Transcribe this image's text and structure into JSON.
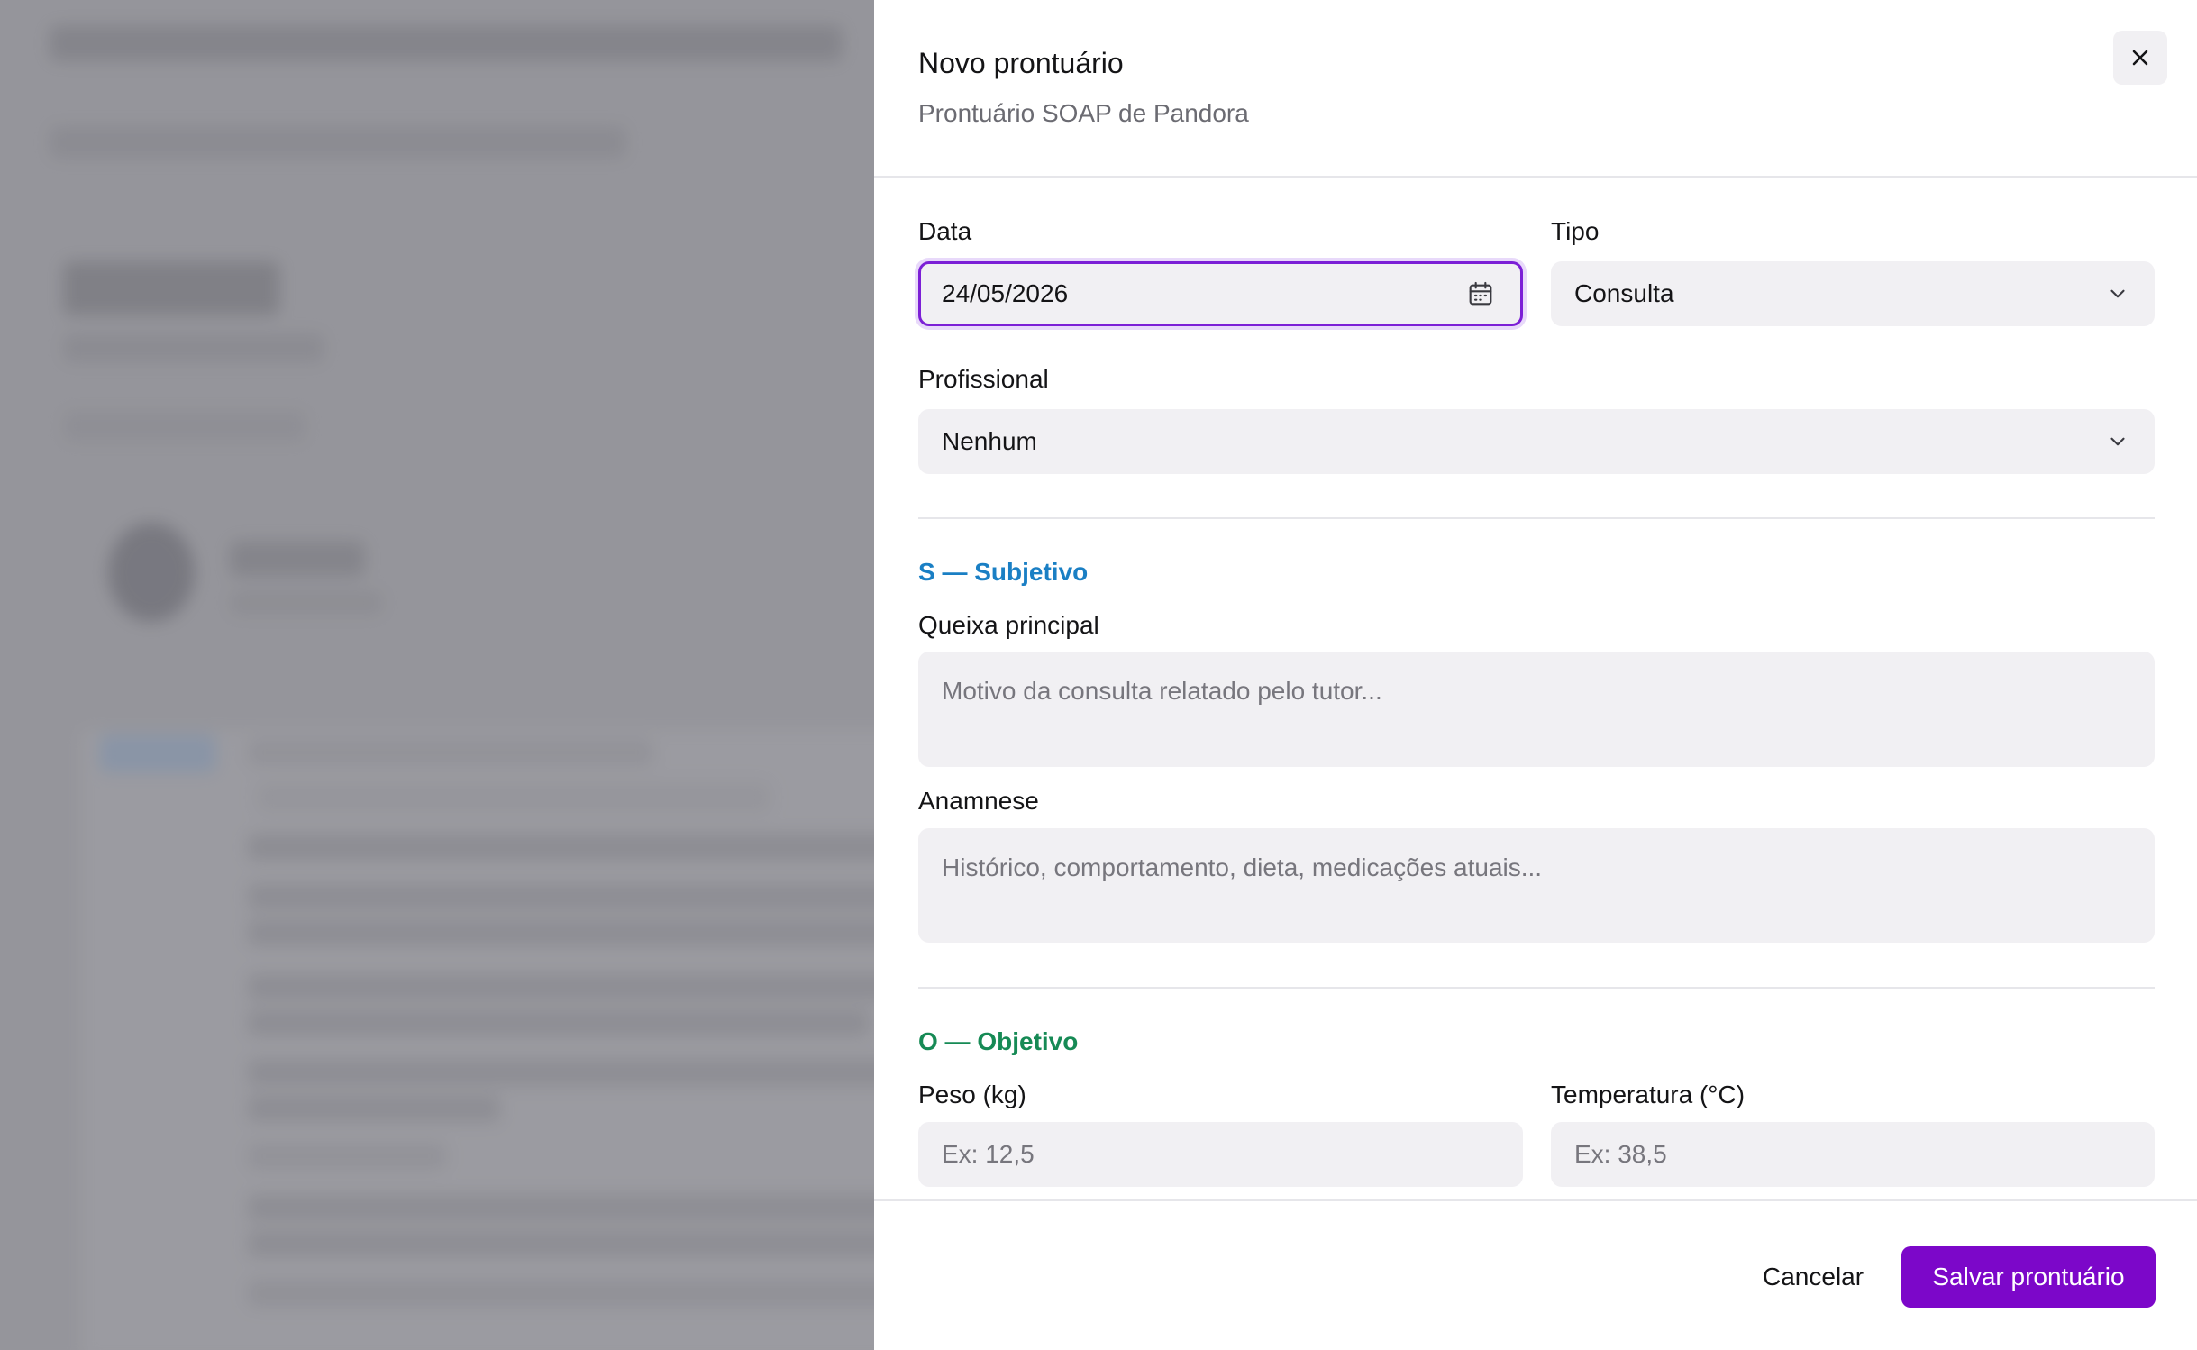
{
  "colors": {
    "accent": "#7c07c9",
    "focus_ring": "#7c1fd6",
    "subjective": "#1a7fc4",
    "objective": "#168a55",
    "field_bg": "#f1f0f3",
    "overlay": "#8a8a90"
  },
  "sheet": {
    "title": "Novo prontuário",
    "subtitle": "Prontuário SOAP de Pandora",
    "close_icon": "close-icon"
  },
  "form": {
    "date": {
      "label": "Data",
      "value": "24/05/2026",
      "icon": "calendar-icon"
    },
    "type": {
      "label": "Tipo",
      "value": "Consulta",
      "icon": "chevron-down-icon"
    },
    "professional": {
      "label": "Profissional",
      "value": "Nenhum",
      "icon": "chevron-down-icon"
    },
    "subjective": {
      "title": "S — Subjetivo",
      "chief_complaint": {
        "label": "Queixa principal",
        "placeholder": "Motivo da consulta relatado pelo tutor..."
      },
      "anamnesis": {
        "label": "Anamnese",
        "placeholder": "Histórico, comportamento, dieta, medicações atuais..."
      }
    },
    "objective": {
      "title": "O — Objetivo",
      "weight": {
        "label": "Peso (kg)",
        "placeholder": "Ex: 12,5"
      },
      "temperature": {
        "label": "Temperatura (°C)",
        "placeholder": "Ex: 38,5"
      }
    }
  },
  "footer": {
    "cancel_label": "Cancelar",
    "save_label": "Salvar prontuário"
  }
}
